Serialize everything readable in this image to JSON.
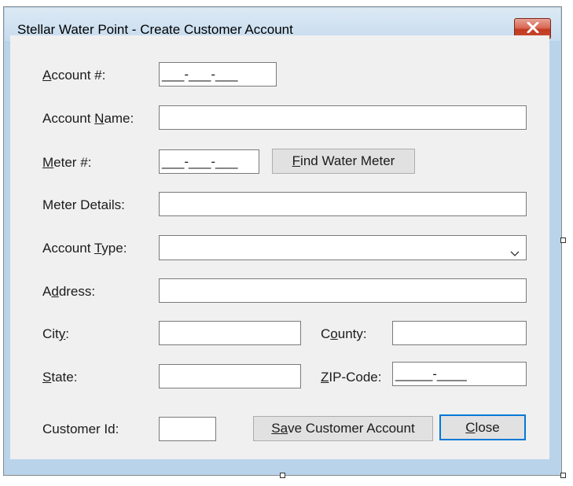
{
  "window": {
    "title": "Stellar Water Point - Create Customer Account"
  },
  "labels": {
    "account_number_pre": "",
    "account_number_acc": "A",
    "account_number_post": "ccount #:",
    "account_name_pre": "Account ",
    "account_name_acc": "N",
    "account_name_post": "ame:",
    "meter_number_acc": "M",
    "meter_number_post": "eter #:",
    "meter_details": "Meter Details:",
    "account_type_pre": "Account ",
    "account_type_acc": "T",
    "account_type_post": "ype:",
    "address_pre": "A",
    "address_acc": "d",
    "address_post": "dress:",
    "city_pre": "Cit",
    "city_acc": "y",
    "city_post": ":",
    "county_pre": "C",
    "county_acc": "o",
    "county_post": "unty:",
    "state_acc": "S",
    "state_post": "tate:",
    "zip_acc": "Z",
    "zip_post": "IP-Code:",
    "customer_id": "Customer Id:"
  },
  "fields": {
    "account_number_mask": "___-___-___",
    "account_name": "",
    "meter_number_mask": "___-___-___",
    "meter_details": "",
    "account_type_selected": "",
    "address": "",
    "city": "",
    "county": "",
    "state": "",
    "zip_mask": "_____-____",
    "customer_id": ""
  },
  "buttons": {
    "find_meter_acc": "F",
    "find_meter_post": "ind Water Meter",
    "save_pre": "S",
    "save_acc": "a",
    "save_post": "ve Customer Account",
    "close_acc": "C",
    "close_post": "lose"
  },
  "icons": {
    "close_window": "close-icon",
    "dropdown": "chevron-down-icon"
  },
  "colors": {
    "title_bar": "#c7dcee",
    "client_area": "#f0f0f0",
    "close_button": "#c94a33",
    "default_button_border": "#0078d7"
  }
}
